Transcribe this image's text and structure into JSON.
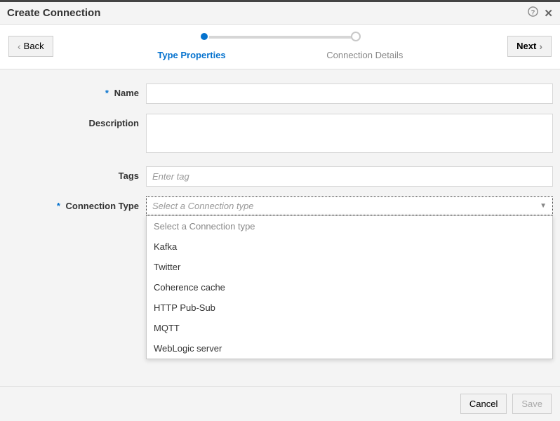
{
  "header": {
    "title": "Create Connection"
  },
  "wizard": {
    "back": "Back",
    "next": "Next",
    "step1": "Type Properties",
    "step2": "Connection Details"
  },
  "form": {
    "name_label": "Name",
    "description_label": "Description",
    "tags_label": "Tags",
    "tags_placeholder": "Enter tag",
    "conntype_label": "Connection Type",
    "conntype_placeholder": "Select a Connection type",
    "options": {
      "o0": "Select a Connection type",
      "o1": "Kafka",
      "o2": "Twitter",
      "o3": "Coherence cache",
      "o4": "HTTP Pub-Sub",
      "o5": "MQTT",
      "o6": "WebLogic server"
    }
  },
  "footer": {
    "cancel": "Cancel",
    "save": "Save"
  }
}
